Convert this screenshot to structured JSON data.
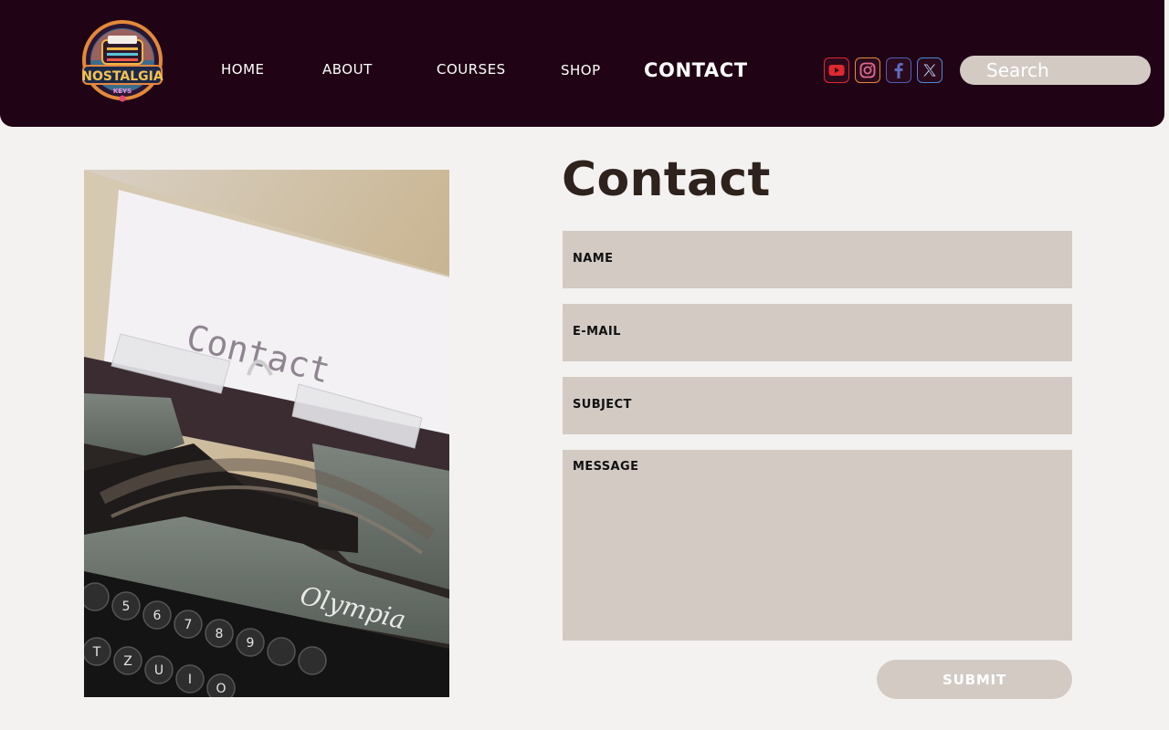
{
  "header": {
    "logo_text": "NOSTALGIA",
    "logo_subtext": "KEYS",
    "nav": {
      "home": "HOME",
      "about": "ABOUT",
      "courses": "COURSES",
      "shop": "SHOP",
      "contact": "CONTACT"
    },
    "social": [
      "youtube-icon",
      "instagram-icon",
      "facebook-icon",
      "x-icon"
    ],
    "search": {
      "placeholder": "Search"
    }
  },
  "photo": {
    "paper_text": "Contact",
    "brand_text": "Olympia",
    "key_labels": [
      "5",
      "6",
      "7",
      "8",
      "9",
      "T",
      "Z",
      "U",
      "I",
      "O"
    ]
  },
  "form": {
    "heading": "Contact",
    "fields": {
      "name": "NAME",
      "email": "E-MAIL",
      "subject": "SUBJECT",
      "message": "MESSAGE"
    },
    "submit": "SUBMIT"
  },
  "colors": {
    "header_bg": "#200314",
    "page_bg": "#f4f2f0",
    "field_bg": "#d3cac4",
    "heading": "#2e221d"
  }
}
